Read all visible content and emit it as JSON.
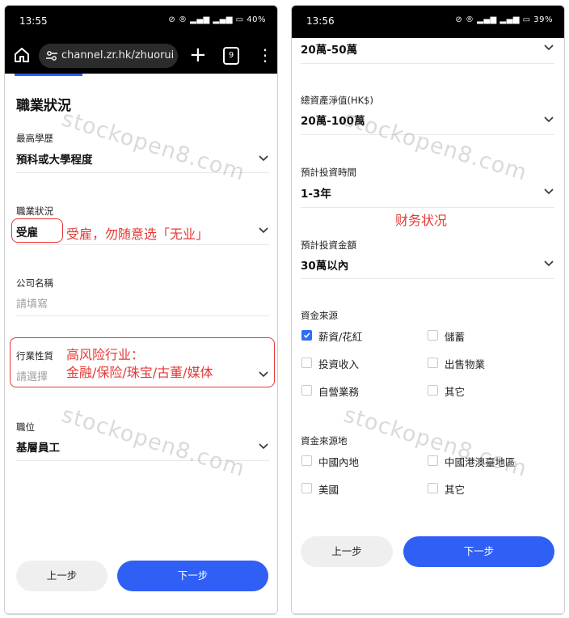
{
  "left": {
    "status": {
      "time": "13:55",
      "battery": "40%"
    },
    "browser": {
      "url": "channel.zr.hk/zhuorui_",
      "tab_count": "9"
    },
    "section_title": "職業狀況",
    "fields": {
      "education": {
        "label": "最高學歷",
        "value": "預科或大學程度"
      },
      "employment": {
        "label": "職業狀況",
        "value": "受雇"
      },
      "company": {
        "label": "公司名稱",
        "placeholder": "請填寫"
      },
      "industry": {
        "label": "行業性質",
        "placeholder": "請選擇"
      },
      "position": {
        "label": "職位",
        "value": "基層員工"
      }
    },
    "notes": {
      "employment_note": "受雇，勿随意选「无业」",
      "industry_note_line1": "高风险行业：",
      "industry_note_line2": "金融/保险/珠宝/古董/媒体"
    },
    "buttons": {
      "prev": "上一步",
      "next": "下一步"
    },
    "watermark": "stockopen8.com"
  },
  "right": {
    "status": {
      "time": "13:56",
      "battery": "39%"
    },
    "fields": {
      "income_range": {
        "value": "20萬-50萬"
      },
      "net_assets": {
        "label": "總資產淨值(HK$)",
        "value": "20萬-100萬"
      },
      "invest_period": {
        "label": "預計投資時間",
        "value": "1-3年"
      },
      "invest_amount": {
        "label": "預計投資金額",
        "value": "30萬以內"
      }
    },
    "finance_note": "财务状况",
    "fund_source": {
      "label": "資金來源",
      "options": [
        {
          "label": "薪資/花紅",
          "checked": true
        },
        {
          "label": "儲蓄",
          "checked": false
        },
        {
          "label": "投資收入",
          "checked": false
        },
        {
          "label": "出售物業",
          "checked": false
        },
        {
          "label": "自營業務",
          "checked": false
        },
        {
          "label": "其它",
          "checked": false
        }
      ]
    },
    "fund_origin": {
      "label": "資金來源地",
      "options": [
        {
          "label": "中國內地",
          "checked": false
        },
        {
          "label": "中國港澳臺地區",
          "checked": false
        },
        {
          "label": "美國",
          "checked": false
        },
        {
          "label": "其它",
          "checked": false
        }
      ]
    },
    "buttons": {
      "prev": "上一步",
      "next": "下一步"
    },
    "watermark": "stockopen8.com"
  },
  "colors": {
    "primary": "#2f5ff5",
    "annotation": "#e53935",
    "checkbox": "#2f6ff5"
  }
}
